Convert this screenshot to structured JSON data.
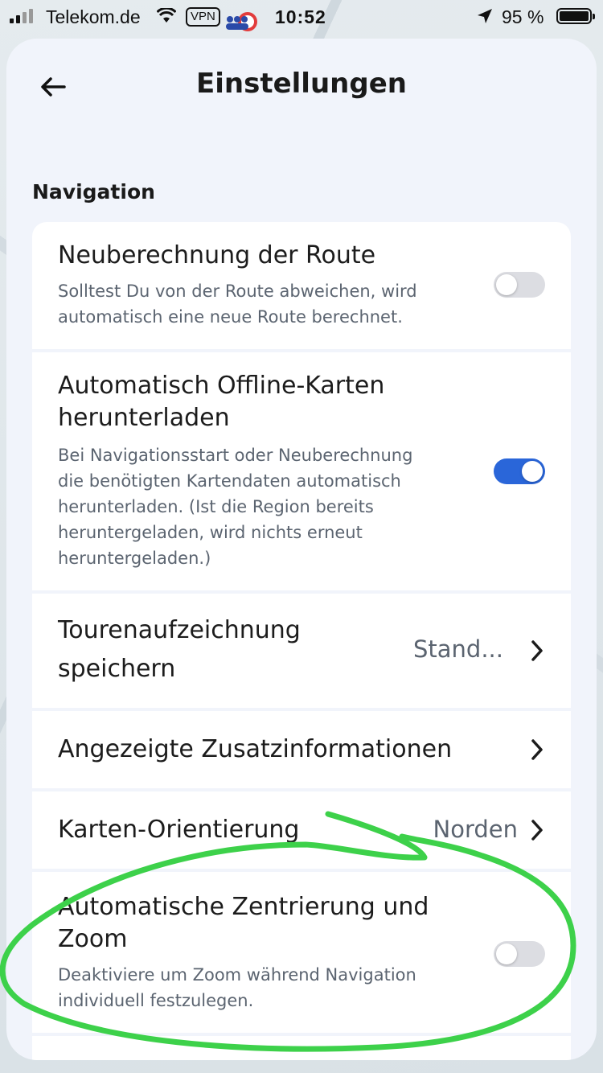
{
  "status_bar": {
    "carrier": "Telekom.de",
    "vpn": "VPN",
    "time": "10:52",
    "battery": "95 %",
    "icons": [
      "signal-icon",
      "wifi-icon",
      "vpn-badge",
      "app-icon",
      "location-arrow-icon",
      "battery-icon"
    ]
  },
  "header": {
    "title": "Einstellungen",
    "back_icon": "arrow-left-icon"
  },
  "section": {
    "label": "Navigation"
  },
  "settings": {
    "reroute": {
      "title": "Neuberechnung der Route",
      "description_line1": "Solltest Du von der Route abweichen, wird",
      "description_line2": "automatisch eine neue Route berechnet.",
      "enabled": false
    },
    "offline_maps": {
      "title_line1": "Automatisch Offline-Karten",
      "title_line2": "herunterladen",
      "description_lines": [
        "Bei Navigationsstart oder Neuberechnung",
        "die benötigten Kartendaten automatisch",
        "herunterladen. (Ist die Region bereits",
        "heruntergeladen, wird nichts erneut",
        "heruntergeladen.)"
      ],
      "enabled": true
    },
    "tour_recording": {
      "title_line1": "Tourenaufzeichnung",
      "title_line2": "speichern",
      "value": "Stand..."
    },
    "extra_info": {
      "title": "Angezeigte Zusatzinformationen"
    },
    "map_orientation": {
      "title": "Karten-Orientierung",
      "value": "Norden"
    },
    "auto_center": {
      "title_line1": "Automatische Zentrierung und",
      "title_line2": "Zoom",
      "description_line1": "Deaktiviere um Zoom während Navigation",
      "description_line2": "individuell festzulegen.",
      "enabled": false
    }
  },
  "colors": {
    "accent": "#2a66d9",
    "annotation": "#3dd14a",
    "sheet_bg": "#f1f4fb",
    "card_bg": "#ffffff",
    "toggle_off": "#dcdde2"
  }
}
